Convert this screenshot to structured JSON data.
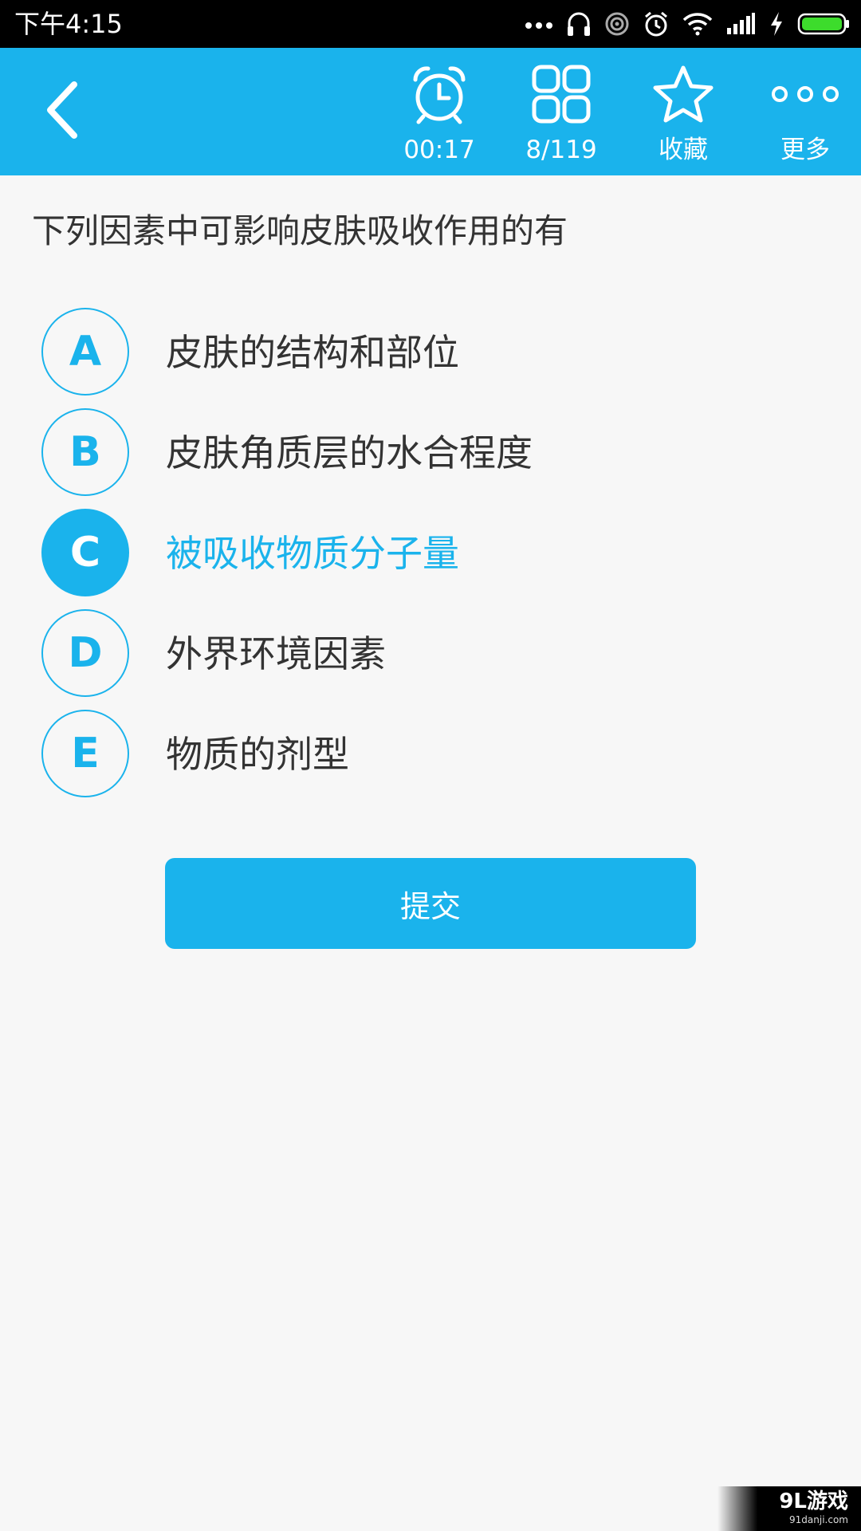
{
  "status_bar": {
    "time": "下午4:15",
    "icons": [
      "more-dots-icon",
      "headset-icon",
      "hotspot-icon",
      "alarm-icon",
      "wifi-icon",
      "signal-icon",
      "charging-icon",
      "battery-icon"
    ]
  },
  "toolbar": {
    "back_icon": "back-arrow-icon",
    "timer": {
      "icon": "alarm-clock-icon",
      "label": "00:17"
    },
    "progress": {
      "icon": "grid-icon",
      "label": "8/119"
    },
    "favorite": {
      "icon": "star-icon",
      "label": "收藏"
    },
    "more": {
      "icon": "three-dots-icon",
      "label": "更多"
    }
  },
  "question": {
    "text": "下列因素中可影响皮肤吸收作用的有"
  },
  "options": [
    {
      "letter": "A",
      "text": "皮肤的结构和部位",
      "selected": false
    },
    {
      "letter": "B",
      "text": "皮肤角质层的水合程度",
      "selected": false
    },
    {
      "letter": "C",
      "text": "被吸收物质分子量",
      "selected": true
    },
    {
      "letter": "D",
      "text": "外界环境因素",
      "selected": false
    },
    {
      "letter": "E",
      "text": "物质的剂型",
      "selected": false
    }
  ],
  "submit": {
    "label": "提交"
  },
  "watermark": {
    "main": "9L游戏",
    "sub": "91danji.com"
  },
  "colors": {
    "accent": "#1ab3ec",
    "background": "#f7f7f7",
    "text": "#333333",
    "status_bar": "#000000",
    "battery": "#3ddc2c"
  }
}
